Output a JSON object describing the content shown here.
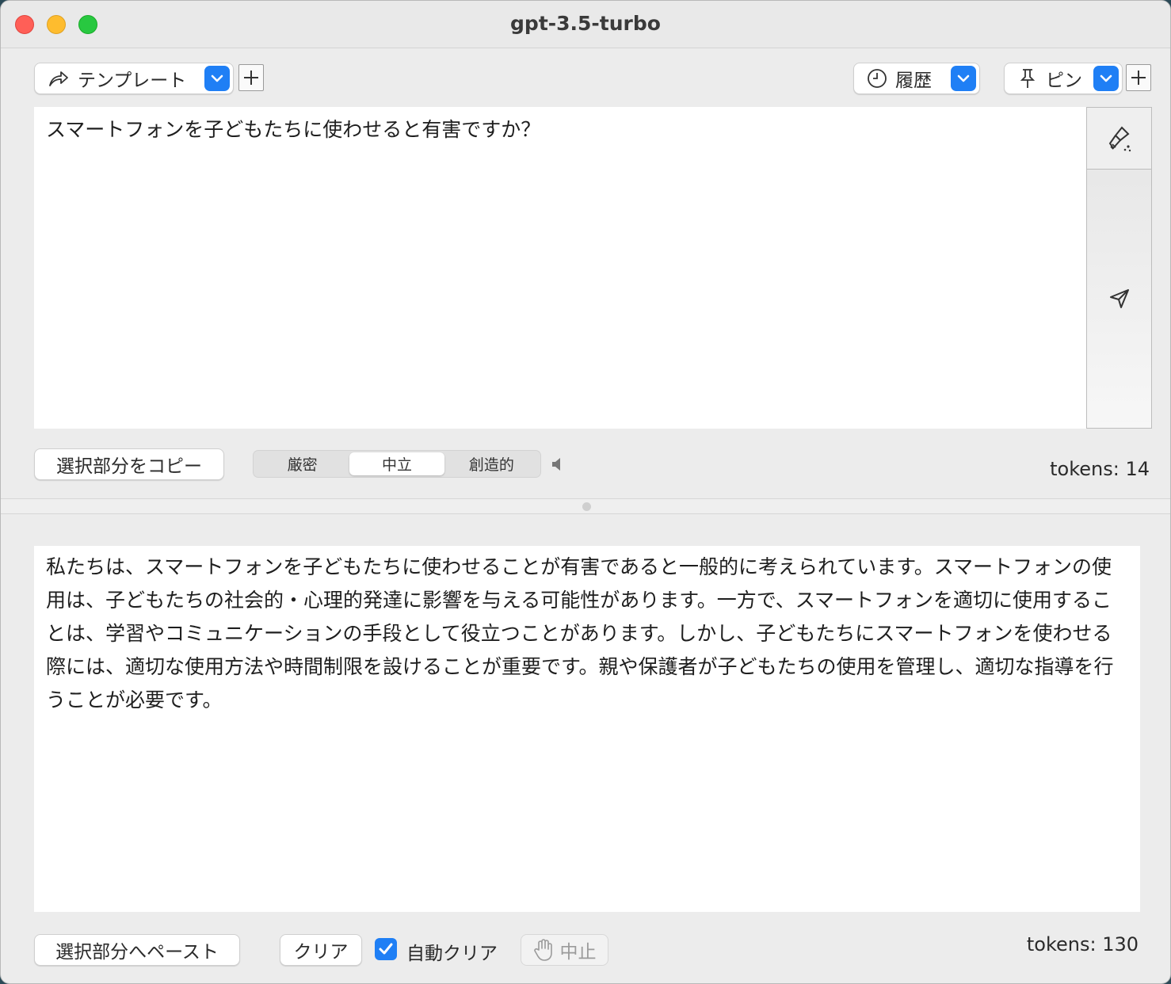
{
  "window": {
    "title": "gpt-3.5-turbo"
  },
  "toolbar": {
    "template_label": "テンプレート",
    "history_label": "履歴",
    "pin_label": "ピン",
    "plus_symbol": "+"
  },
  "prompt": {
    "text": "スマートフォンを子どもたちに使わせると有害ですか？",
    "copy_button": "選択部分をコピー",
    "modes": [
      "厳密",
      "中立",
      "創造的"
    ],
    "active_mode": "中立",
    "tokens": "tokens: 14"
  },
  "response": {
    "text": "私たちは、スマートフォンを子どもたちに使わせることが有害であると一般的に考えられています。スマートフォンの使用は、子どもたちの社会的・心理的発達に影響を与える可能性があります。一方で、スマートフォンを適切に使用することは、学習やコミュニケーションの手段として役立つことがあります。しかし、子どもたちにスマートフォンを使わせる際には、適切な使用方法や時間制限を設けることが重要です。親や保護者が子どもたちの使用を管理し、適切な指導を行うことが必要です。",
    "paste_button": "選択部分へペースト",
    "clear_button": "クリア",
    "auto_clear_label": "自動クリア",
    "auto_clear_checked": true,
    "stop_button": "中止",
    "tokens": "tokens: 130"
  },
  "colors": {
    "accent": "#1f7ff5"
  }
}
